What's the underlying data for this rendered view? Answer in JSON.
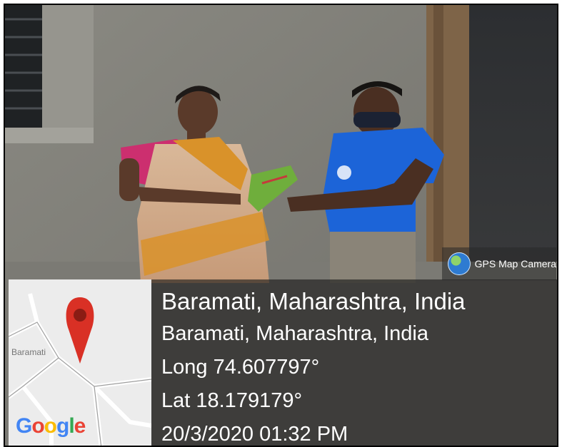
{
  "overlay": {
    "badge_label": "GPS Map Camera",
    "map_place_label": "Baramati",
    "map_brand": "Google",
    "address_line": "Baramati, Maharashtra, India",
    "address_detail": "Baramati, Maharashtra, India",
    "longitude": "Long 74.607797°",
    "latitude": "Lat 18.179179°",
    "datetime": "20/3/2020 01:32 PM"
  },
  "colors": {
    "map_pin": "#d93025",
    "google_blue": "#4285f4",
    "google_red": "#ea4335",
    "google_yellow": "#fbbc05",
    "google_green": "#34a853"
  }
}
